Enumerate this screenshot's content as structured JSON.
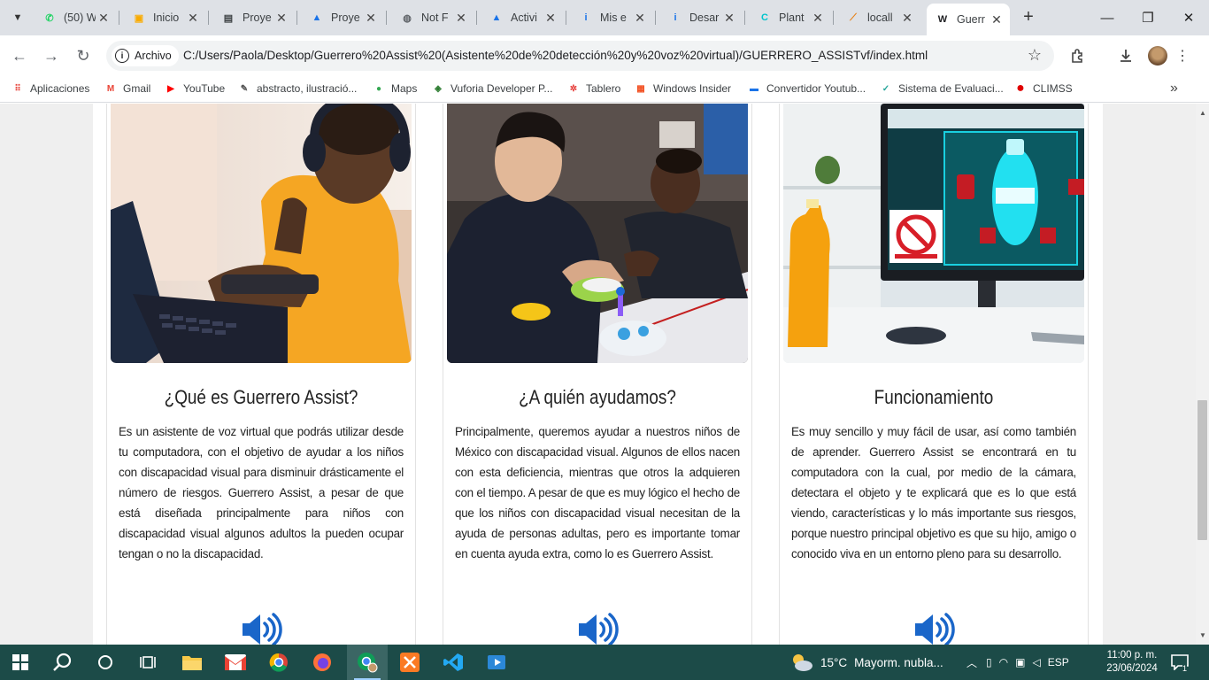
{
  "browser": {
    "tabs": [
      {
        "title": "(50) W",
        "icon": "whatsapp-icon",
        "color": "#25d366"
      },
      {
        "title": "Inicio",
        "icon": "classroom-icon",
        "color": "#f9ab00"
      },
      {
        "title": "Proye",
        "icon": "document-icon",
        "color": "#3c4043"
      },
      {
        "title": "Proye",
        "icon": "google-drive-icon",
        "color": "#1a73e8"
      },
      {
        "title": "Not F",
        "icon": "globe-icon",
        "color": "#5f6368"
      },
      {
        "title": "Activi",
        "icon": "google-drive-icon",
        "color": "#1a73e8"
      },
      {
        "title": "Mis e",
        "icon": "info-icon",
        "color": "#1a73e8"
      },
      {
        "title": "Desar",
        "icon": "info-icon",
        "color": "#1a73e8"
      },
      {
        "title": "Plant",
        "icon": "canva-icon",
        "color": "#00c4cc"
      },
      {
        "title": "locall",
        "icon": "phpmyadmin-icon",
        "color": "#e77f13"
      },
      {
        "title": "Guerr",
        "icon": "wix-icon",
        "color": "#202124"
      }
    ],
    "url_chip": "Archivo",
    "url": "C:/Users/Paola/Desktop/Guerrero%20Assist%20(Asistente%20de%20detección%20y%20voz%20virtual)/GUERRERO_ASSISTvf/index.html",
    "bookmarks": [
      {
        "label": "Aplicaciones",
        "icon": "apps-grid-icon"
      },
      {
        "label": "Gmail",
        "icon": "gmail-icon"
      },
      {
        "label": "YouTube",
        "icon": "youtube-icon"
      },
      {
        "label": "abstracto, ilustració...",
        "icon": "image-site-icon"
      },
      {
        "label": "Maps",
        "icon": "maps-pin-icon"
      },
      {
        "label": "Vuforia Developer P...",
        "icon": "vuforia-icon"
      },
      {
        "label": "Tablero",
        "icon": "tablero-icon"
      },
      {
        "label": "Windows Insider",
        "icon": "windows-logo-icon"
      },
      {
        "label": "Convertidor Youtub...",
        "icon": "video-converter-icon"
      },
      {
        "label": "Sistema de Evaluaci...",
        "icon": "evaluation-icon"
      },
      {
        "label": "CLIMSS",
        "icon": "red-circle-icon"
      }
    ]
  },
  "cards": [
    {
      "title": "¿Qué es Guerrero Assist?",
      "text": "Es un asistente de voz virtual que podrás utilizar desde tu computadora, con el objetivo de ayudar a los niños con discapacidad visual para disminuir drásticamente el número de riesgos. Guerrero Assist, a pesar de que está diseñada principalmente para niños con discapacidad visual algunos adultos la pueden ocupar tengan o no la discapacidad."
    },
    {
      "title": "¿A quién ayudamos?",
      "text": "Principalmente, queremos ayudar a nuestros niños de México con discapacidad visual. Algunos de ellos nacen con esta deficiencia, mientras que otros la adquieren con el tiempo. A pesar de que es muy lógico el hecho de que los niños con discapacidad visual necesitan de la ayuda de personas adultas, pero es importante tomar en cuenta ayuda extra, como lo es Guerrero Assist."
    },
    {
      "title": "Funcionamiento",
      "text": "Es muy sencillo y muy fácil de usar, así como también de aprender. Guerrero Assist se encontrará en tu computadora con la cual, por medio de la cámara, detectara el objeto y te explicará que es lo que está viendo, características y lo más importante sus riesgos, porque nuestro principal objetivo es que su hijo, amigo o conocido viva en un entorno pleno para su desarrollo."
    }
  ],
  "taskbar": {
    "weather_temp": "15°C",
    "weather_desc": "Mayorm. nubla...",
    "lang": "ESP",
    "time": "11:00 p. m.",
    "date": "23/06/2024",
    "notifications": "1"
  },
  "colors": {
    "accent_blue": "#1a66c9",
    "taskbar": "#1c4b48"
  }
}
